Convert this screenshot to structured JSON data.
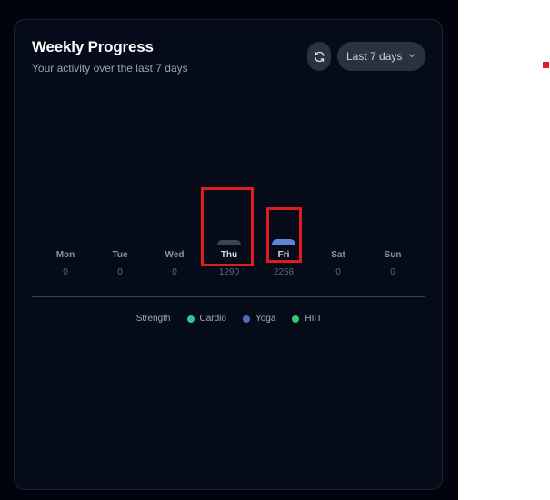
{
  "header": {
    "title": "Weekly Progress",
    "subtitle": "Your activity over the last 7 days",
    "refresh_icon": "refresh-icon",
    "range_label": "Last 7 days",
    "range_icon": "chevron-down-icon"
  },
  "chart_data": {
    "type": "bar",
    "categories": [
      "Mon",
      "Tue",
      "Wed",
      "Thu",
      "Fri",
      "Sat",
      "Sun"
    ],
    "values": [
      0,
      0,
      0,
      1290,
      2258,
      0,
      0
    ],
    "value_labels": [
      "0",
      "0",
      "0",
      "1290",
      "2258",
      "0",
      "0"
    ],
    "bar_colors": [
      "#3b4454",
      "#3b4454",
      "#3b4454",
      "#3b4454",
      "#5b86d6",
      "#3b4454",
      "#3b4454"
    ]
  },
  "legend": {
    "items": [
      {
        "label": "Strength",
        "color": ""
      },
      {
        "label": "Cardio",
        "color": "#2fc2b4"
      },
      {
        "label": "Yoga",
        "color": "#4d6fb8"
      },
      {
        "label": "HIIT",
        "color": "#2ecb6f"
      }
    ]
  },
  "colors": {
    "background": "#02040d",
    "card": "#060b1a",
    "highlight": "#e01d1d"
  }
}
